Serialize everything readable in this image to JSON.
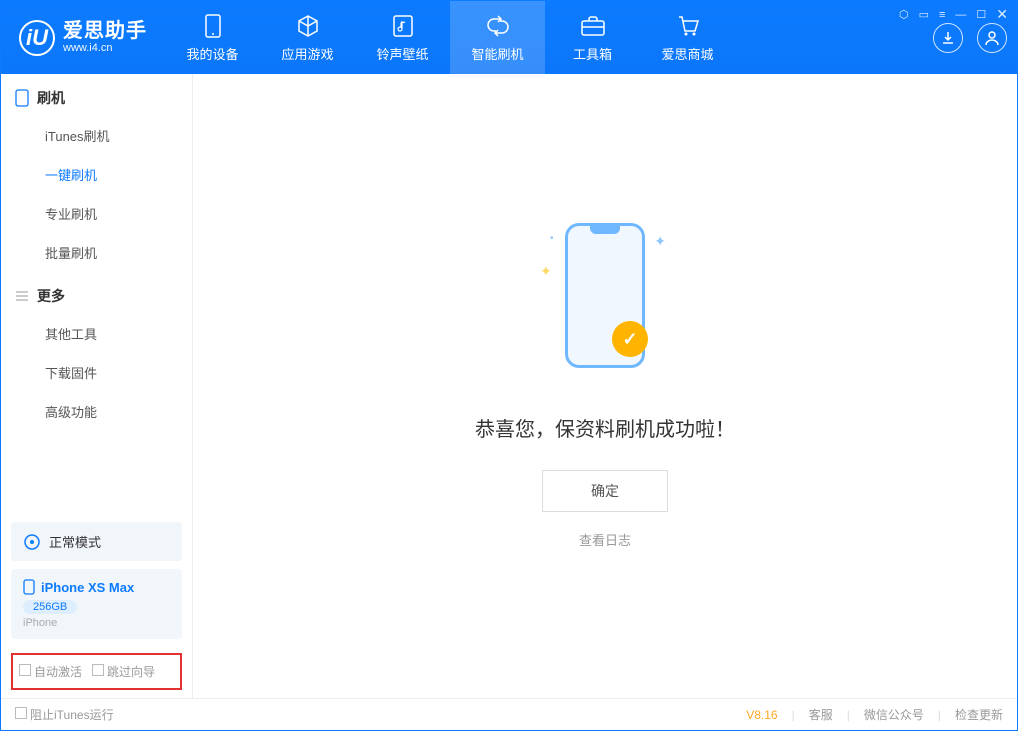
{
  "app": {
    "title": "爱思助手",
    "url": "www.i4.cn",
    "logo_letter": "iU"
  },
  "nav": {
    "tabs": [
      {
        "label": "我的设备",
        "icon": "device-icon"
      },
      {
        "label": "应用游戏",
        "icon": "cube-icon"
      },
      {
        "label": "铃声壁纸",
        "icon": "music-icon"
      },
      {
        "label": "智能刷机",
        "icon": "refresh-icon",
        "active": true
      },
      {
        "label": "工具箱",
        "icon": "toolbox-icon"
      },
      {
        "label": "爱思商城",
        "icon": "shop-icon"
      }
    ]
  },
  "sidebar": {
    "section1": {
      "title": "刷机",
      "icon": "phone-icon"
    },
    "items1": [
      {
        "label": "iTunes刷机"
      },
      {
        "label": "一键刷机",
        "active": true
      },
      {
        "label": "专业刷机"
      },
      {
        "label": "批量刷机"
      }
    ],
    "section2": {
      "title": "更多",
      "icon": "menu-icon"
    },
    "items2": [
      {
        "label": "其他工具"
      },
      {
        "label": "下载固件"
      },
      {
        "label": "高级功能"
      }
    ],
    "mode": {
      "label": "正常模式",
      "icon": "recovery-icon"
    },
    "device": {
      "name": "iPhone XS Max",
      "storage": "256GB",
      "type": "iPhone"
    },
    "checkboxes": {
      "auto_activate": "自动激活",
      "skip_wizard": "跳过向导"
    }
  },
  "main": {
    "success_message": "恭喜您，保资料刷机成功啦！",
    "ok_button": "确定",
    "view_log": "查看日志"
  },
  "footer": {
    "block_itunes": "阻止iTunes运行",
    "version": "V8.16",
    "support": "客服",
    "wechat": "微信公众号",
    "check_update": "检查更新"
  }
}
